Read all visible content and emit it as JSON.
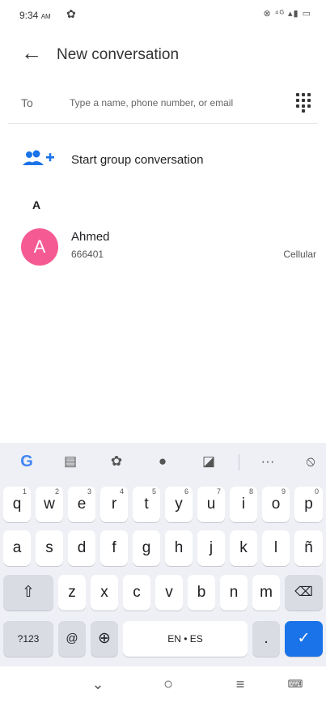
{
  "status_bar": {
    "time": "9:34",
    "ampm": "AM",
    "right_icons": "⊗ ⁴ᴳ ▴▮ ▭"
  },
  "app_bar": {
    "title": "New conversation"
  },
  "to_row": {
    "label": "To",
    "placeholder": "Type a name, phone number, or email"
  },
  "group": {
    "label": "Start group conversation"
  },
  "section_header": "A",
  "contacts": [
    {
      "initial": "A",
      "name": "Ahmed",
      "number": "666401",
      "type": "Cellular",
      "avatar_color": "#f55a92"
    }
  ],
  "keyboard": {
    "toolbar": [
      "G",
      "clipboard-icon",
      "gear-icon",
      "palette-icon",
      "translate-icon",
      "more-icon",
      "mic-off-icon"
    ],
    "row1": [
      {
        "k": "q",
        "h": "1"
      },
      {
        "k": "w",
        "h": "2"
      },
      {
        "k": "e",
        "h": "3"
      },
      {
        "k": "r",
        "h": "4"
      },
      {
        "k": "t",
        "h": "5"
      },
      {
        "k": "y",
        "h": "6"
      },
      {
        "k": "u",
        "h": "7"
      },
      {
        "k": "i",
        "h": "8"
      },
      {
        "k": "o",
        "h": "9"
      },
      {
        "k": "p",
        "h": "0"
      }
    ],
    "row2": [
      "a",
      "s",
      "d",
      "f",
      "g",
      "h",
      "j",
      "k",
      "l",
      "ñ"
    ],
    "row3": [
      "z",
      "x",
      "c",
      "v",
      "b",
      "n",
      "m"
    ],
    "row4": {
      "sym": "?123",
      "at": "@",
      "space": "EN • ES",
      "period": "."
    }
  },
  "colors": {
    "accent": "#1a73e8",
    "avatar": "#f55a92",
    "keyboard_bg": "#eef0f5"
  }
}
